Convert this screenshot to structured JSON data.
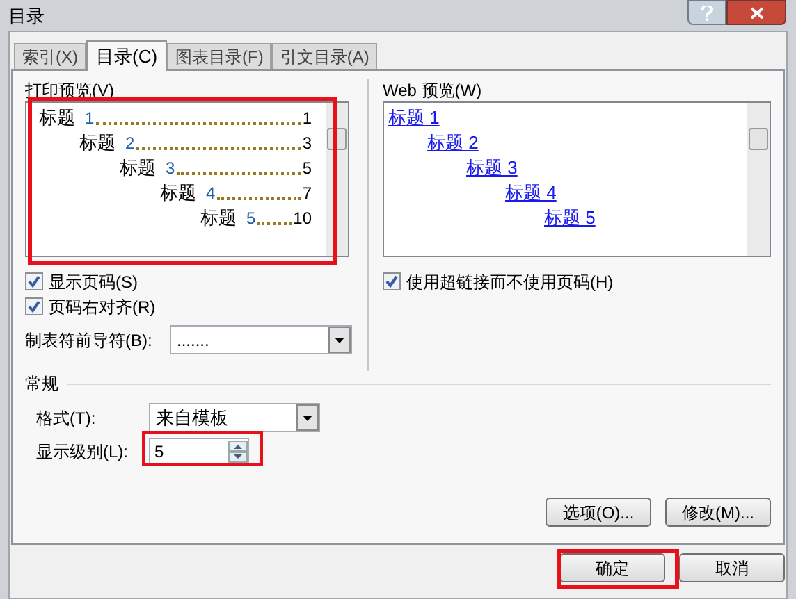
{
  "window": {
    "title": "目录"
  },
  "tabs": [
    {
      "label": "索引(X)",
      "selected": false
    },
    {
      "label": "目录(C)",
      "selected": true
    },
    {
      "label": "图表目录(F)",
      "selected": false
    },
    {
      "label": "引文目录(A)",
      "selected": false
    }
  ],
  "print_preview": {
    "label": "打印预览(V)",
    "highlighted": true,
    "entries": [
      {
        "heading": "标题",
        "number": "1",
        "page": "1",
        "children": [
          {
            "heading": "标题",
            "number": "2",
            "page": "3",
            "children": [
              {
                "heading": "标题",
                "number": "3",
                "page": "5",
                "children": [
                  {
                    "heading": "标题",
                    "number": "4",
                    "page": "7",
                    "children": [
                      {
                        "heading": "标题",
                        "number": "5",
                        "page": "10"
                      }
                    ]
                  }
                ]
              }
            ]
          }
        ]
      }
    ]
  },
  "print_options": [
    {
      "label": "显示页码(S)",
      "checked": true
    },
    {
      "label": "页码右对齐(R)",
      "checked": true
    }
  ],
  "tab_leader": {
    "label": "制表符前导符(B):",
    "value": "......."
  },
  "web_preview": {
    "label": "Web 预览(W)",
    "entries": [
      {
        "text": "标题 1",
        "children": [
          {
            "text": "标题 2",
            "children": [
              {
                "text": "标题 3",
                "children": [
                  {
                    "text": "标题 4",
                    "children": [
                      {
                        "text": "标题 5"
                      }
                    ]
                  }
                ]
              }
            ]
          }
        ]
      }
    ]
  },
  "web_options": [
    {
      "label": "使用超链接而不使用页码(H)",
      "checked": true
    }
  ],
  "general": {
    "heading": "常规",
    "format": {
      "label": "格式(T):",
      "value": "来自模板"
    },
    "show_levels": {
      "label": "显示级别(L):",
      "value": "5",
      "highlighted": true
    }
  },
  "panel_buttons": [
    {
      "label": "选项(O)..."
    },
    {
      "label": "修改(M)..."
    }
  ],
  "dialog_buttons": [
    {
      "label": "确定",
      "highlighted": true
    },
    {
      "label": "取消",
      "highlighted": false
    }
  ]
}
